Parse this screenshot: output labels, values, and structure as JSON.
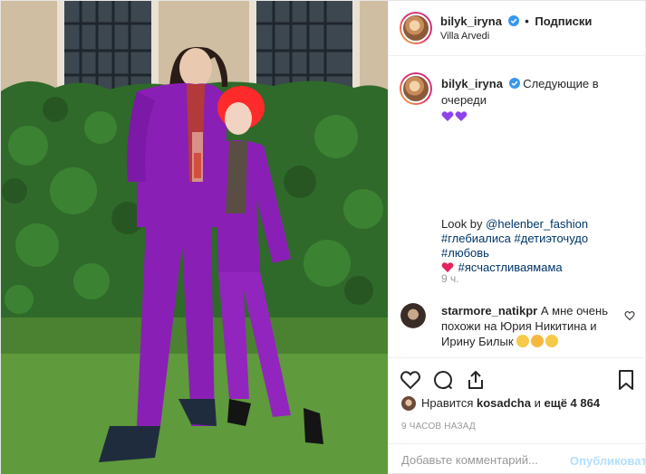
{
  "post": {
    "author": "bilyk_iryna",
    "follow_label": "Подписки",
    "location": "Villa Arvedi",
    "caption_text": "Следующие в очереди",
    "caption_look_prefix": "Look by ",
    "caption_look_mention": "@helenber_fashion",
    "hashtags": [
      "#глебиалиса",
      "#детиэточудо",
      "#любовь",
      "#ясчастливаямама"
    ],
    "time_ago": "9 ч.",
    "posted": "9 ЧАСОВ НАЗАД"
  },
  "comment": {
    "author": "starmore_natikpr",
    "text": "А мне очень похожи на Юрия Никитина и Ирину Билык"
  },
  "likes": {
    "prefix": "Нравится",
    "user": "kosadcha",
    "middle": "и",
    "others": "ещё 4 864"
  },
  "add_comment": {
    "placeholder": "Добавьте комментарий...",
    "publish_label": "Опубликовать"
  },
  "colors": {
    "link": "#003569",
    "muted": "#999999",
    "verified": "#3897f0",
    "purple_heart": "#8e44ec",
    "suit": "#8a1fb5",
    "hedge": "#2f6a2a"
  },
  "icons": [
    "verified-icon",
    "purple-heart-icon",
    "red-heart-icon",
    "emoji-icon",
    "heart-icon",
    "comment-icon",
    "share-icon",
    "bookmark-icon"
  ]
}
